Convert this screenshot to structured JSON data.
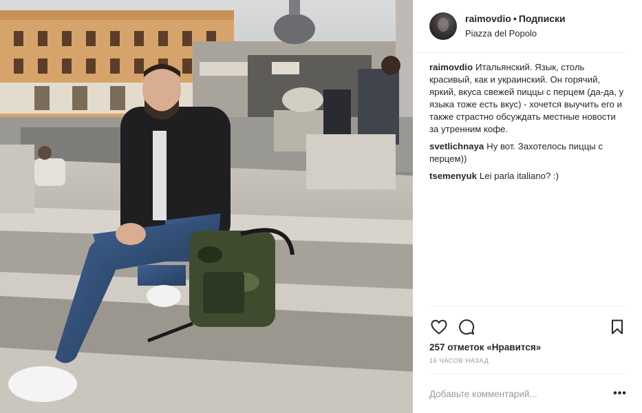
{
  "header": {
    "username": "raimovdio",
    "separator": "•",
    "follow_label": "Подписки",
    "location": "Piazza del Popolo"
  },
  "comments": [
    {
      "user": "raimovdio",
      "text": "Итальянский. Язык, столь красивый, как и украинский. Он горячий, яркий, вкуса свежей пиццы с перцем (да-да, у языка тоже есть вкус) - хочется выучить его и также страстно обсуждать местные новости за утренним кофе."
    },
    {
      "user": "svetlichnaya",
      "text": "Ну вот. Захотелось пиццы с перцем))"
    },
    {
      "user": "tsemenyuk",
      "text": "Lei parla italiano? :)"
    }
  ],
  "actions": {
    "like_icon": "heart-icon",
    "comment_icon": "comment-icon",
    "save_icon": "bookmark-icon"
  },
  "likes_text": "257 отметок «Нравится»",
  "time_text": "16 часов назад",
  "add_comment": {
    "placeholder": "Добавьте комментарий...",
    "more_label": "•••"
  },
  "colors": {
    "text": "#262626",
    "muted": "#999999",
    "divider": "#efefef"
  }
}
